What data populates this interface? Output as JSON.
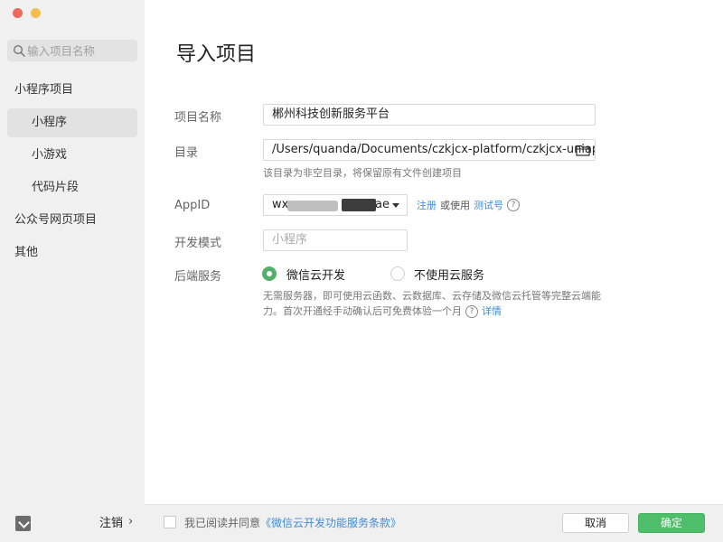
{
  "window": {
    "traffic_lights": [
      "close",
      "minimize"
    ]
  },
  "sidebar": {
    "search_placeholder": "输入项目名称",
    "groups": [
      {
        "label": "小程序项目",
        "level": 0,
        "active": false
      },
      {
        "label": "小程序",
        "level": 1,
        "active": true
      },
      {
        "label": "小游戏",
        "level": 1,
        "active": false
      },
      {
        "label": "代码片段",
        "level": 1,
        "active": false
      },
      {
        "label": "公众号网页项目",
        "level": 0,
        "active": false
      },
      {
        "label": "其他",
        "level": 0,
        "active": false
      }
    ],
    "logout_label": "注销",
    "logout_chevron": "›"
  },
  "main": {
    "title": "导入项目",
    "form": {
      "project_name": {
        "label": "项目名称",
        "value": "郴州科技创新服务平台"
      },
      "directory": {
        "label": "目录",
        "value": "/Users/quanda/Documents/czkjcx-platform/czkjcx-uniapp",
        "hint": "该目录为非空目录，将保留原有文件创建项目",
        "icon": "folder-icon"
      },
      "appid": {
        "label": "AppID",
        "value_prefix": "wx",
        "value_suffix": "ae",
        "register_link": "注册",
        "or_use_text": "或使用",
        "test_link": "测试号",
        "help": "?"
      },
      "dev_mode": {
        "label": "开发模式",
        "placeholder": "小程序"
      },
      "backend": {
        "label": "后端服务",
        "options": [
          "微信云开发",
          "不使用云服务"
        ],
        "selected": 0,
        "desc_line1": "无需服务器，即可使用云函数、云数据库、云存储及微信云托管等完整云端能",
        "desc_line2": "力。首次开通经手动确认后可免费体验一个月",
        "help": "?",
        "details_link": "详情"
      }
    }
  },
  "footer": {
    "agree_text": "我已阅读并同意",
    "agree_link": "《微信云开发功能服务条款》",
    "cancel_label": "取消",
    "ok_label": "确定"
  },
  "colors": {
    "accent_green": "#4fbe6a",
    "link_blue": "#3f8bd8",
    "sidebar_bg": "#f0f0f0"
  }
}
